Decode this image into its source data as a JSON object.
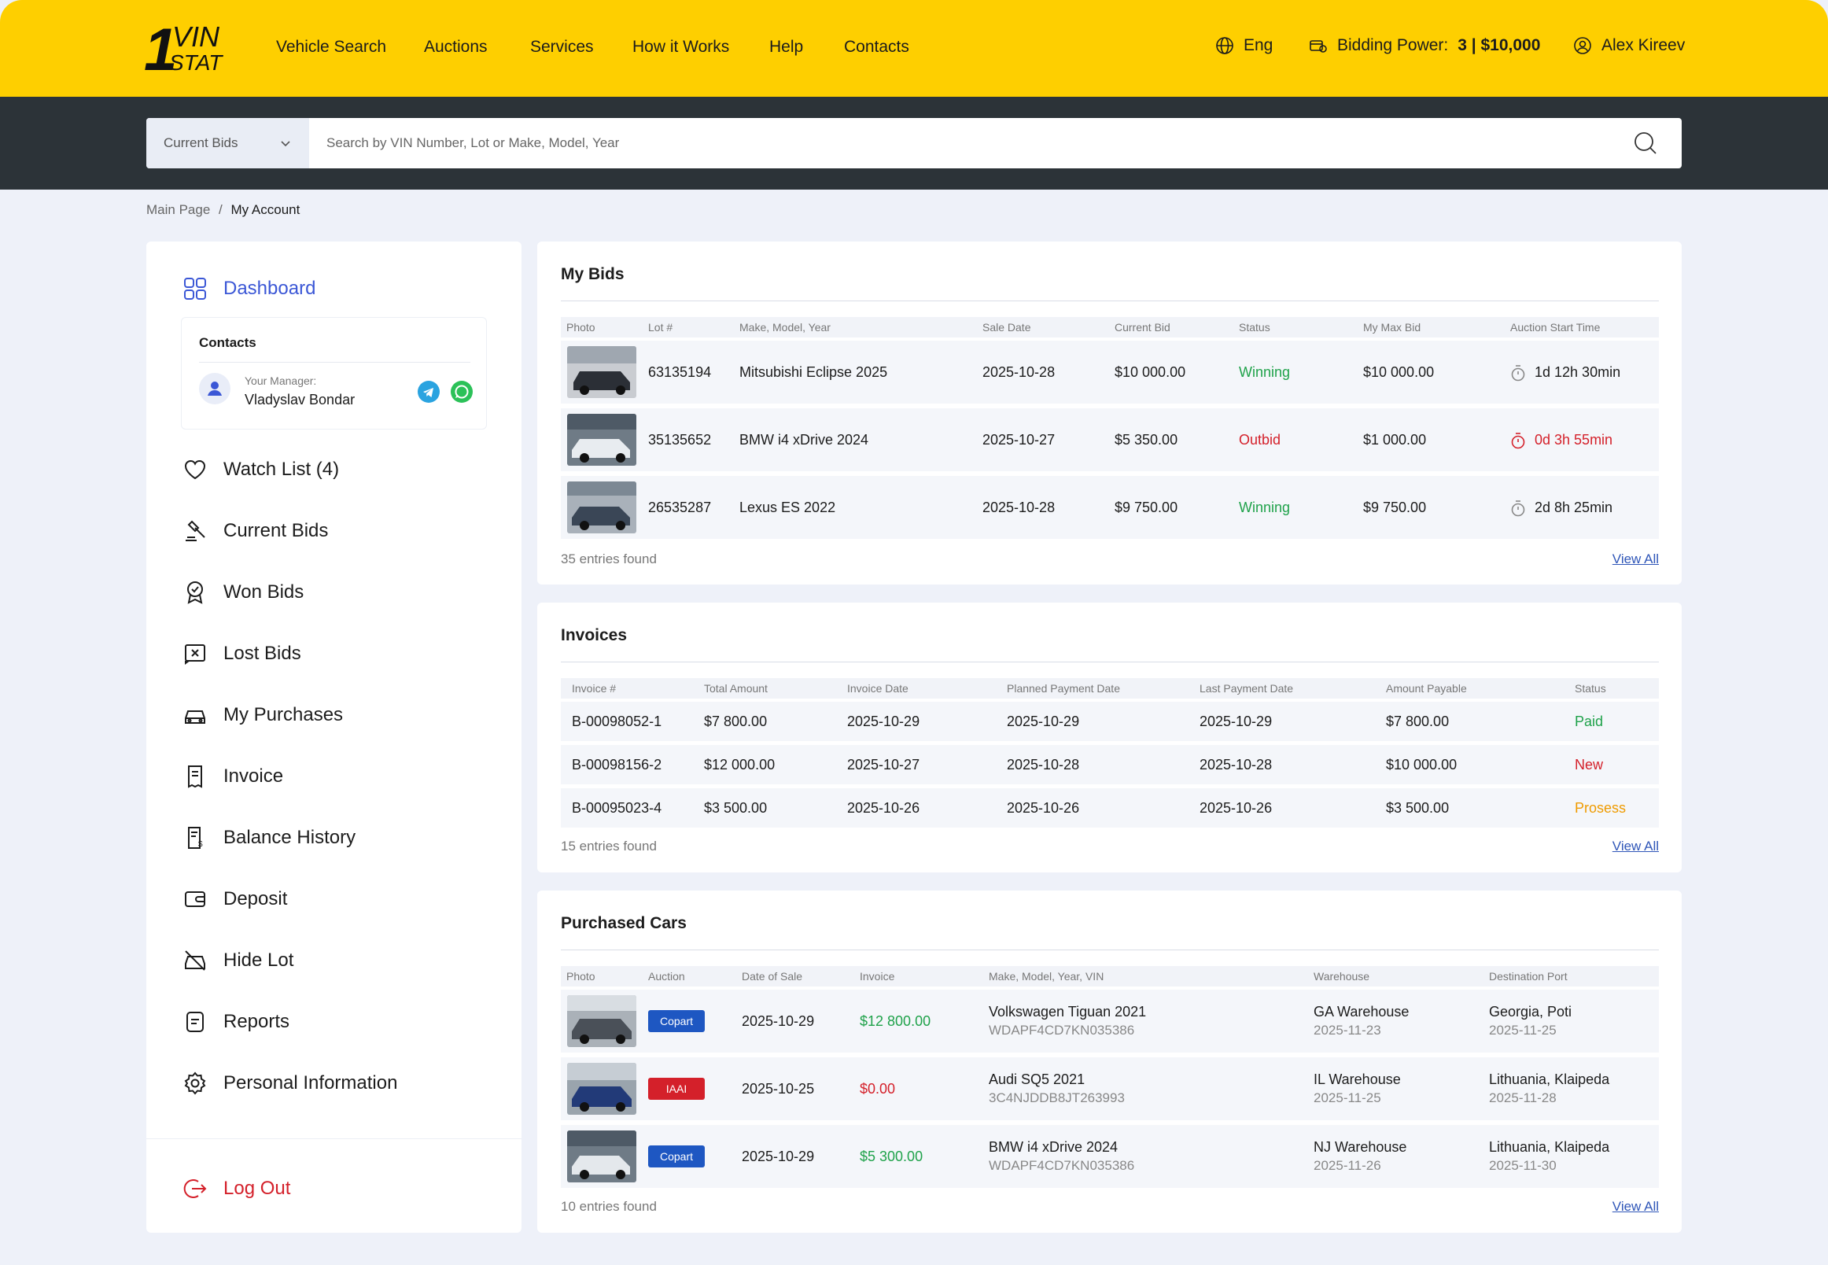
{
  "brand": {
    "logo_num": "1",
    "logo_top": "VIN",
    "logo_bottom": "STAT"
  },
  "nav": [
    "Vehicle Search",
    "Auctions",
    "Services",
    "How it Works",
    "Help",
    "Contacts"
  ],
  "header": {
    "language": "Eng",
    "bidding_power_label": "Bidding Power:",
    "bidding_power_value": "3 | $10,000",
    "user_name": "Alex Kireev"
  },
  "search": {
    "category": "Current Bids",
    "placeholder": "Search by VIN Number, Lot or Make, Model, Year"
  },
  "breadcrumb": {
    "home": "Main Page",
    "sep": "/",
    "current": "My Account"
  },
  "sidebar": {
    "dashboard": "Dashboard",
    "contacts_title": "Contacts",
    "manager_label": "Your Manager:",
    "manager_name": "Vladyslav Bondar",
    "items": [
      {
        "label": "Watch List (4)",
        "icon": "heart-icon"
      },
      {
        "label": "Current Bids",
        "icon": "gavel-icon"
      },
      {
        "label": "Won Bids",
        "icon": "award-icon"
      },
      {
        "label": "Lost Bids",
        "icon": "x-box-icon"
      },
      {
        "label": "My Purchases",
        "icon": "car-icon"
      },
      {
        "label": "Invoice",
        "icon": "receipt-icon"
      },
      {
        "label": "Balance History",
        "icon": "balance-icon"
      },
      {
        "label": "Deposit",
        "icon": "wallet-icon"
      },
      {
        "label": "Hide Lot",
        "icon": "hidden-car-icon"
      },
      {
        "label": "Reports",
        "icon": "document-icon"
      },
      {
        "label": "Personal Information",
        "icon": "gear-icon"
      }
    ],
    "logout": "Log Out"
  },
  "my_bids": {
    "title": "My Bids",
    "columns": [
      "Photo",
      "Lot #",
      "Make, Model, Year",
      "Sale Date",
      "Current Bid",
      "Status",
      "My Max Bid",
      "Auction Start Time"
    ],
    "rows": [
      {
        "lot": "63135194",
        "model": "Mitsubishi Eclipse 2025",
        "sale_date": "2025-10-28",
        "current_bid": "$10 000.00",
        "status": "Winning",
        "max_bid": "$10 000.00",
        "time": "1d 12h 30min",
        "car_color": "#2b2f36"
      },
      {
        "lot": "35135652",
        "model": "BMW i4 xDrive 2024",
        "sale_date": "2025-10-27",
        "current_bid": "$5 350.00",
        "status": "Outbid",
        "max_bid": "$1 000.00",
        "time": "0d 3h 55min",
        "car_color": "#e8ecf0"
      },
      {
        "lot": "26535287",
        "model": "Lexus ES 2022",
        "sale_date": "2025-10-28",
        "current_bid": "$9 750.00",
        "status": "Winning",
        "max_bid": "$9 750.00",
        "time": "2d 8h 25min",
        "car_color": "#3a4656"
      }
    ],
    "entries": "35 entries found",
    "view_all": "View All"
  },
  "invoices": {
    "title": "Invoices",
    "columns": [
      "Invoice #",
      "Total Amount",
      "Invoice Date",
      "Planned Payment Date",
      "Last Payment Date",
      "Amount Payable",
      "Status"
    ],
    "rows": [
      {
        "id": "B-00098052-1",
        "total": "$7 800.00",
        "date": "2025-10-29",
        "planned": "2025-10-29",
        "last": "2025-10-29",
        "payable": "$7 800.00",
        "status": "Paid"
      },
      {
        "id": "B-00098156-2",
        "total": "$12 000.00",
        "date": "2025-10-27",
        "planned": "2025-10-28",
        "last": "2025-10-28",
        "payable": "$10 000.00",
        "status": "New"
      },
      {
        "id": "B-00095023-4",
        "total": "$3 500.00",
        "date": "2025-10-26",
        "planned": "2025-10-26",
        "last": "2025-10-26",
        "payable": "$3 500.00",
        "status": "Prosess"
      }
    ],
    "entries": "15 entries found",
    "view_all": "View All"
  },
  "purchased": {
    "title": "Purchased Cars",
    "columns": [
      "Photo",
      "Auction",
      "Date of Sale",
      "Invoice",
      "Make, Model, Year, VIN",
      "Warehouse",
      "Destination Port"
    ],
    "rows": [
      {
        "auction": "Copart",
        "date": "2025-10-29",
        "invoice": "$12 800.00",
        "model": "Volkswagen Tiguan 2021",
        "vin": "WDAPF4CD7KN035386",
        "warehouse": "GA Warehouse",
        "wh_date": "2025-11-23",
        "port": "Georgia, Poti",
        "port_date": "2025-11-25",
        "car_color": "#4a5058"
      },
      {
        "auction": "IAAI",
        "date": "2025-10-25",
        "invoice": "$0.00",
        "model": "Audi SQ5 2021",
        "vin": "3C4NJDDB8JT263993",
        "warehouse": "IL Warehouse",
        "wh_date": "2025-11-25",
        "port": "Lithuania, Klaipeda",
        "port_date": "2025-11-28",
        "car_color": "#223a78"
      },
      {
        "auction": "Copart",
        "date": "2025-10-29",
        "invoice": "$5 300.00",
        "model": "BMW i4 xDrive 2024",
        "vin": "WDAPF4CD7KN035386",
        "warehouse": "NJ Warehouse",
        "wh_date": "2025-11-26",
        "port": "Lithuania, Klaipeda",
        "port_date": "2025-11-30",
        "car_color": "#e4e8ec"
      }
    ],
    "entries": "10 entries found",
    "view_all": "View All"
  },
  "colors": {
    "accent_yellow": "#fecf00",
    "band": "#2c3338",
    "link_blue": "#2f56b8",
    "green": "#1fa24a",
    "red": "#d4202a",
    "orange": "#ef9b00"
  }
}
